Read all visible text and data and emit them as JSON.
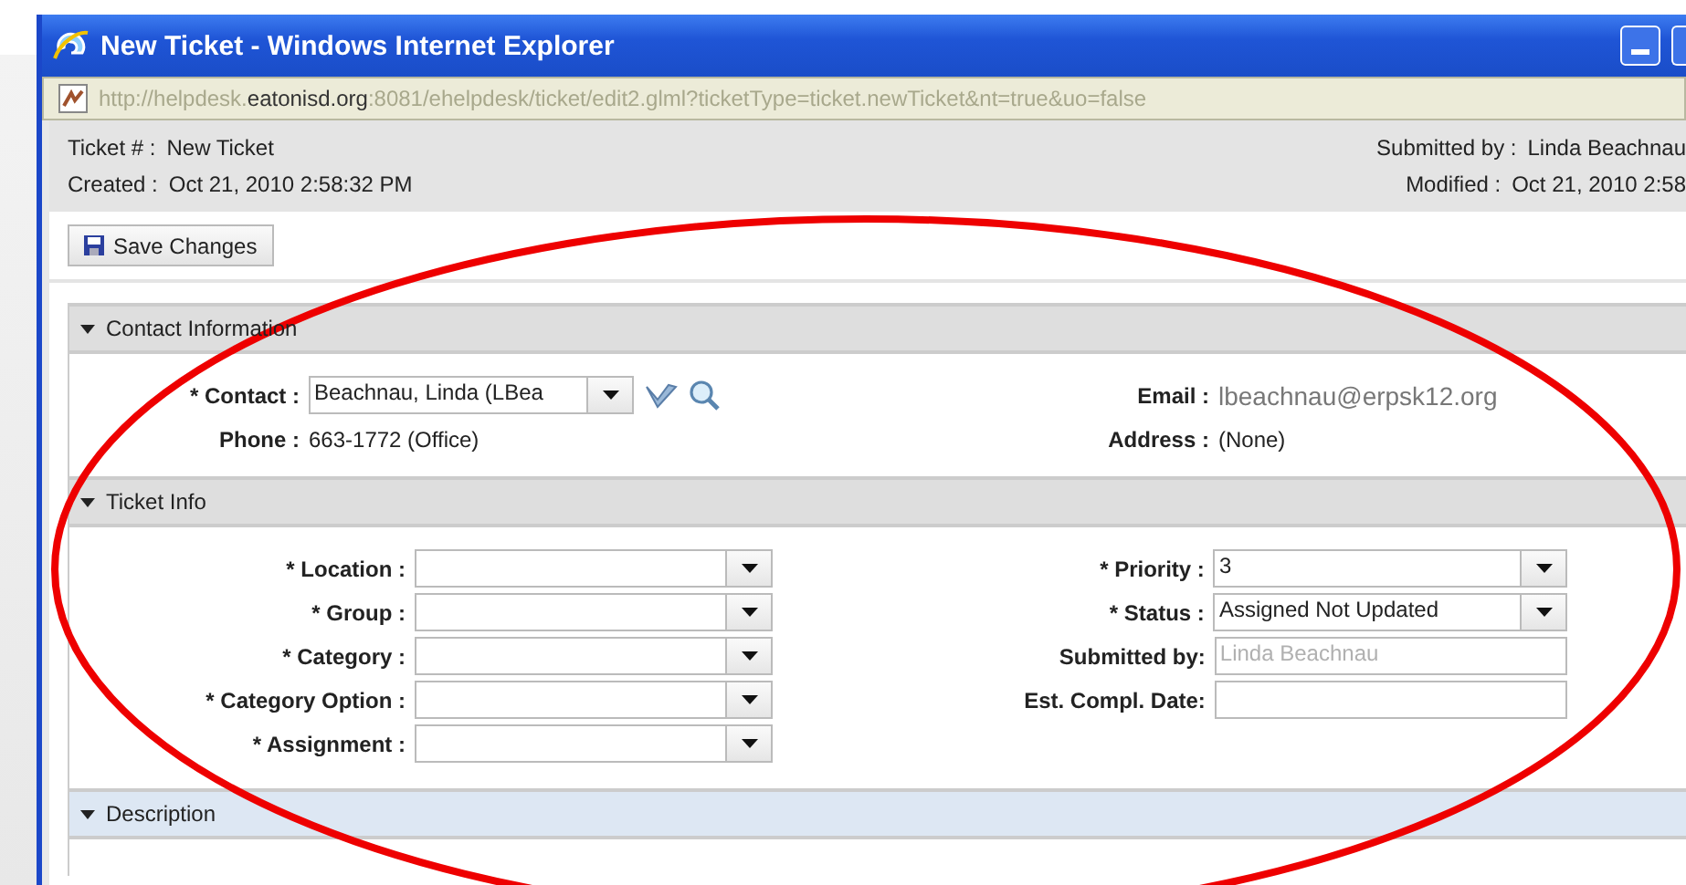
{
  "window": {
    "title": "New Ticket - Windows Internet Explorer"
  },
  "address_bar": {
    "prefix": "http://helpdesk.",
    "domain": "eatonisd.org",
    "suffix": ":8081/ehelpdesk/ticket/edit2.glml?ticketType=ticket.newTicket&nt=true&uo=false"
  },
  "header": {
    "left": [
      {
        "label": "Ticket # :",
        "value": "New Ticket"
      },
      {
        "label": "Created :",
        "value": "Oct 21, 2010 2:58:32 PM"
      }
    ],
    "right": [
      {
        "label": "Submitted by :",
        "value": "Linda Beachnau"
      },
      {
        "label": "Modified :",
        "value": "Oct 21, 2010 2:58"
      }
    ]
  },
  "toolbar": {
    "save_button": "Save Changes"
  },
  "sections": [
    {
      "kind": "contact",
      "title": "Contact Information",
      "expanded": true,
      "left": [
        {
          "kind": "combo",
          "label": "* Contact :",
          "value": "Beachnau, Linda (LBea"
        },
        {
          "kind": "text",
          "label": "Phone :",
          "value": "663-1772 (Office)"
        }
      ],
      "right": [
        {
          "kind": "link",
          "label": "Email :",
          "value": "lbeachnau@erpsk12.org"
        },
        {
          "kind": "text",
          "label": "Address :",
          "value": "(None)"
        }
      ]
    },
    {
      "kind": "fields",
      "title": "Ticket Info",
      "expanded": true,
      "left": [
        {
          "kind": "select",
          "label": "* Location :"
        },
        {
          "kind": "select",
          "label": "* Group :"
        },
        {
          "kind": "select",
          "label": "* Category :"
        },
        {
          "kind": "select",
          "label": "* Category Option :"
        },
        {
          "kind": "select",
          "label": "* Assignment :"
        }
      ],
      "right": [
        {
          "kind": "select",
          "label": "* Priority :",
          "value": "3"
        },
        {
          "kind": "select",
          "label": "* Status :",
          "value": "Assigned Not Updated"
        },
        {
          "kind": "readonly",
          "label": "Submitted by:",
          "value": "Linda Beachnau",
          "disabled": true
        },
        {
          "kind": "input",
          "label": "Est. Compl. Date:"
        }
      ]
    },
    {
      "kind": "empty",
      "title": "Description",
      "expanded": true
    }
  ]
}
